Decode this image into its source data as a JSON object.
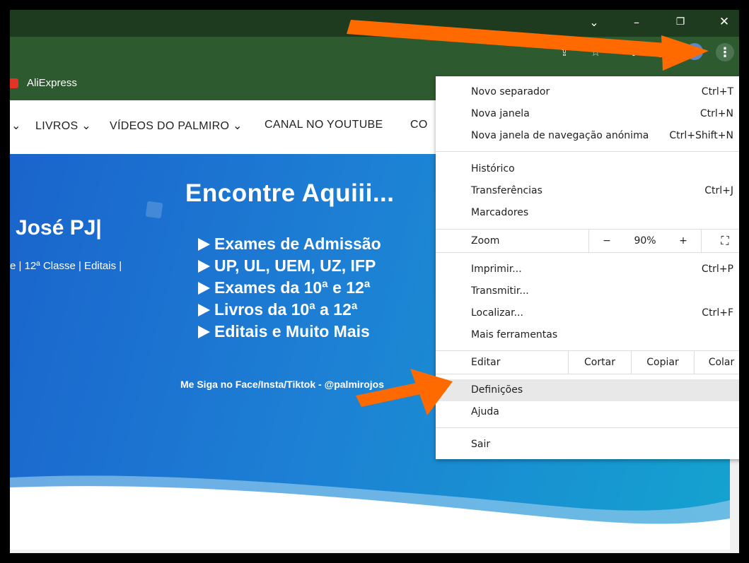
{
  "window_controls": {
    "collapse_glyph": "⌄",
    "minimize_glyph": "–",
    "restore_glyph": "❐",
    "close_glyph": "✕"
  },
  "toolbar": {
    "share_glyph": "⇪",
    "bookmark_glyph": "☆",
    "extensions_glyph": "✚",
    "sidepanel_glyph": "▣",
    "menu_glyph": "⋮"
  },
  "bookmarks": {
    "aliexpress_label": "AliExpress"
  },
  "site_nav": {
    "items": [
      {
        "label": "⌄"
      },
      {
        "label": "LIVROS ⌄"
      },
      {
        "label": "VÍDEOS DO PALMIRO ⌄"
      },
      {
        "label": "CANAL NO YOUTUBE"
      },
      {
        "label": "CO"
      }
    ]
  },
  "hero": {
    "title": "José PJ|",
    "subtitle": "e | 12ª Classe | Editais |",
    "promo_title": "Encontre Aquiii...",
    "promo_items": [
      "Exames de Admissão",
      "UP, UL, UEM, UZ, IFP",
      "Exames da 10ª e 12ª",
      "Livros da 10ª a 12ª",
      "Editais e Muito Mais"
    ],
    "promo_footer": "Me Siga no Face/Insta/Tiktok - @palmirojos"
  },
  "menu": {
    "new_tab": {
      "label": "Novo separador",
      "shortcut": "Ctrl+T"
    },
    "new_window": {
      "label": "Nova janela",
      "shortcut": "Ctrl+N"
    },
    "incognito": {
      "label": "Nova janela de navegação anónima",
      "shortcut": "Ctrl+Shift+N"
    },
    "history": {
      "label": "Histórico"
    },
    "downloads": {
      "label": "Transferências",
      "shortcut": "Ctrl+J"
    },
    "bookmarks": {
      "label": "Marcadores"
    },
    "zoom": {
      "label": "Zoom",
      "minus": "−",
      "value": "90%",
      "plus": "+",
      "fullscreen_glyph": "⛶"
    },
    "print": {
      "label": "Imprimir...",
      "shortcut": "Ctrl+P"
    },
    "cast": {
      "label": "Transmitir..."
    },
    "find": {
      "label": "Localizar...",
      "shortcut": "Ctrl+F"
    },
    "more_tools": {
      "label": "Mais ferramentas"
    },
    "edit": {
      "label": "Editar",
      "cut": "Cortar",
      "copy": "Copiar",
      "paste": "Colar"
    },
    "settings": {
      "label": "Definições"
    },
    "help": {
      "label": "Ajuda"
    },
    "exit": {
      "label": "Sair"
    }
  },
  "colors": {
    "annotation_arrow": "#ff6a00",
    "titlebar": "#1e3a1f",
    "toolbar": "#2d5a2f",
    "hero_start": "#1a64cc",
    "hero_end": "#14a3cf",
    "menu_highlight": "#e8e8e8"
  }
}
